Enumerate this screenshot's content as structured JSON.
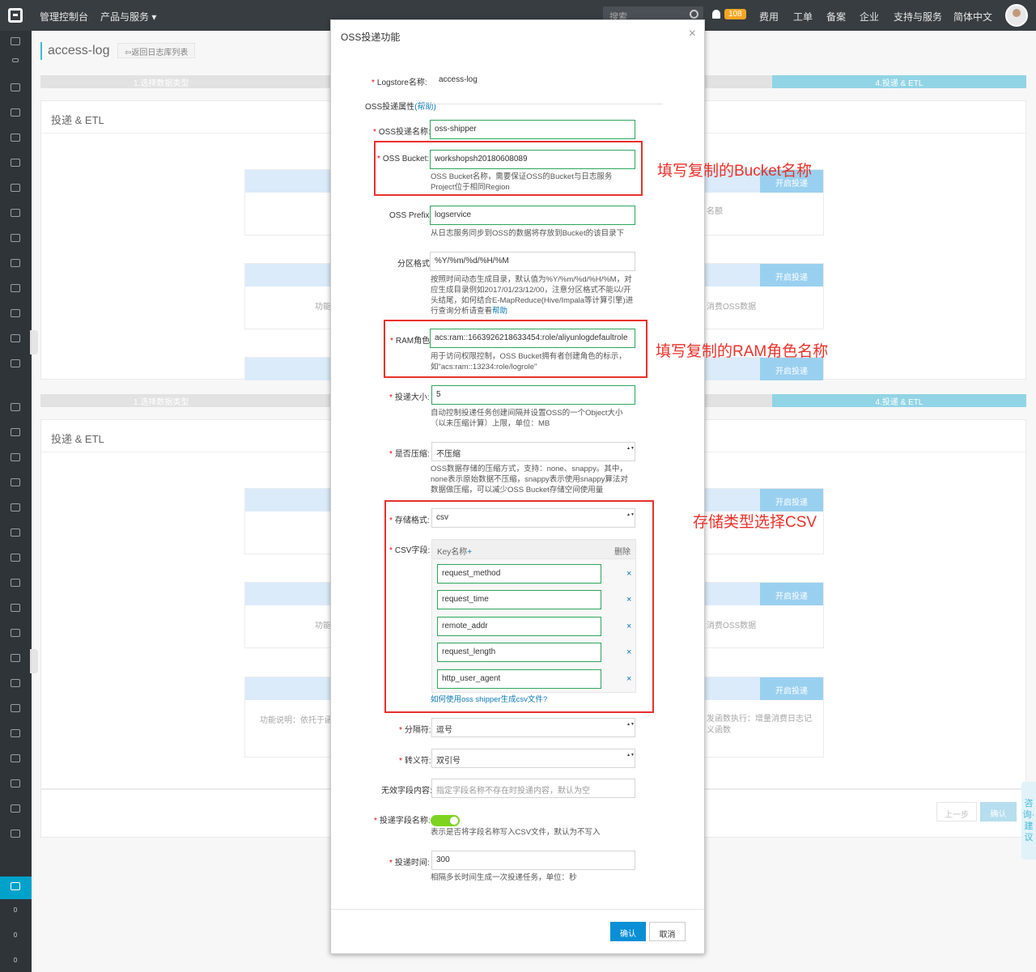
{
  "topbar": {
    "console": "管理控制台",
    "products": "产品与服务 ▾",
    "search_placeholder": "搜索",
    "badge": "108",
    "links": [
      "费用",
      "工单",
      "备案",
      "企业",
      "支持与服务",
      "简体中文"
    ]
  },
  "background": {
    "title": "access-log",
    "back_label": "⇦返回日志库列表",
    "step1": "1.选择数据类型",
    "step4": "4.投递 & ETL",
    "panel_title": "投递 & ETL",
    "card_button": "开启投递",
    "card_left_text": "功能说明：依托于函数",
    "card_left_short": "功能",
    "card_right_text": "消费OSS数据",
    "card_right_text2": "发函数执行：增量消费日志记",
    "card_right_text3": "义函数",
    "card_right_short": "名额",
    "prev": "上一步",
    "ok": "确认",
    "consult": "咨询·建议"
  },
  "dialog": {
    "title": "OSS投递功能",
    "close": "×",
    "logstore_label": "Logstore名称:",
    "logstore_value": "access-log",
    "section_title": "OSS投递属性",
    "section_help": "(帮助)",
    "name_label": "OSS投递名称:",
    "name_value": "oss-shipper",
    "bucket_label": "OSS Bucket:",
    "bucket_value": "workshopsh20180608089",
    "bucket_hint": "OSS Bucket名称，需要保证OSS的Bucket与日志服务Project位于相同Region",
    "prefix_label": "OSS Prefix:",
    "prefix_value": "logservice",
    "prefix_hint": "从日志服务同步到OSS的数据将存放到Bucket的该目录下",
    "partition_label": "分区格式:",
    "partition_value": "%Y/%m/%d/%H/%M",
    "partition_hint": "按照时间动态生成目录，默认值为%Y/%m/%d/%H/%M，对应生成目录例如2017/01/23/12/00，注意分区格式不能以/开头结尾，如何结合E-MapReduce(Hive/Impala等计算引擎)进行查询分析请查看",
    "partition_help": "帮助",
    "ram_label": "RAM角色:",
    "ram_value": "acs:ram::1663926218633454:role/aliyunlogdefaultrole",
    "ram_hint": "用于访问权限控制，OSS Bucket拥有者创建角色的标示，如\"acs:ram::13234:role/logrole\"",
    "size_label": "投递大小:",
    "size_value": "5",
    "size_hint": "自动控制投递任务创建间隔并设置OSS的一个Object大小（以未压缩计算）上限，单位：MB",
    "compress_label": "是否压缩:",
    "compress_value": "不压缩",
    "compress_hint": "OSS数据存储的压缩方式，支持：none、snappy。其中，none表示原始数据不压缩，snappy表示使用snappy算法对数据做压缩，可以减少OSS Bucket存储空间使用量",
    "format_label": "存储格式:",
    "format_value": "csv",
    "csv_label": "CSV字段:",
    "csv_key_header": "Key名称",
    "csv_add": "+",
    "csv_delete_header": "删除",
    "csv_fields": [
      "request_method",
      "request_time",
      "remote_addr",
      "request_length",
      "http_user_agent"
    ],
    "csv_remove": "×",
    "csv_help_link": "如何使用oss shipper生成csv文件?",
    "delimiter_label": "分隔符:",
    "delimiter_value": "逗号",
    "escape_label": "转义符:",
    "escape_value": "双引号",
    "invalid_label": "无效字段内容:",
    "invalid_placeholder": "指定字段名称不存在时投递内容，默认为空",
    "header_label": "投递字段名称:",
    "header_hint": "表示是否将字段名称写入CSV文件，默认为不写入",
    "time_label": "投递时间:",
    "time_value": "300",
    "time_hint": "相隔多长时间生成一次投递任务，单位：秒",
    "ok": "确认",
    "cancel": "取消"
  },
  "annotations": {
    "bucket_note": "填写复制的Bucket名称",
    "ram_note": "填写复制的RAM角色名称",
    "csv_note": "存储类型选择CSV",
    "color": "#e8312a"
  }
}
